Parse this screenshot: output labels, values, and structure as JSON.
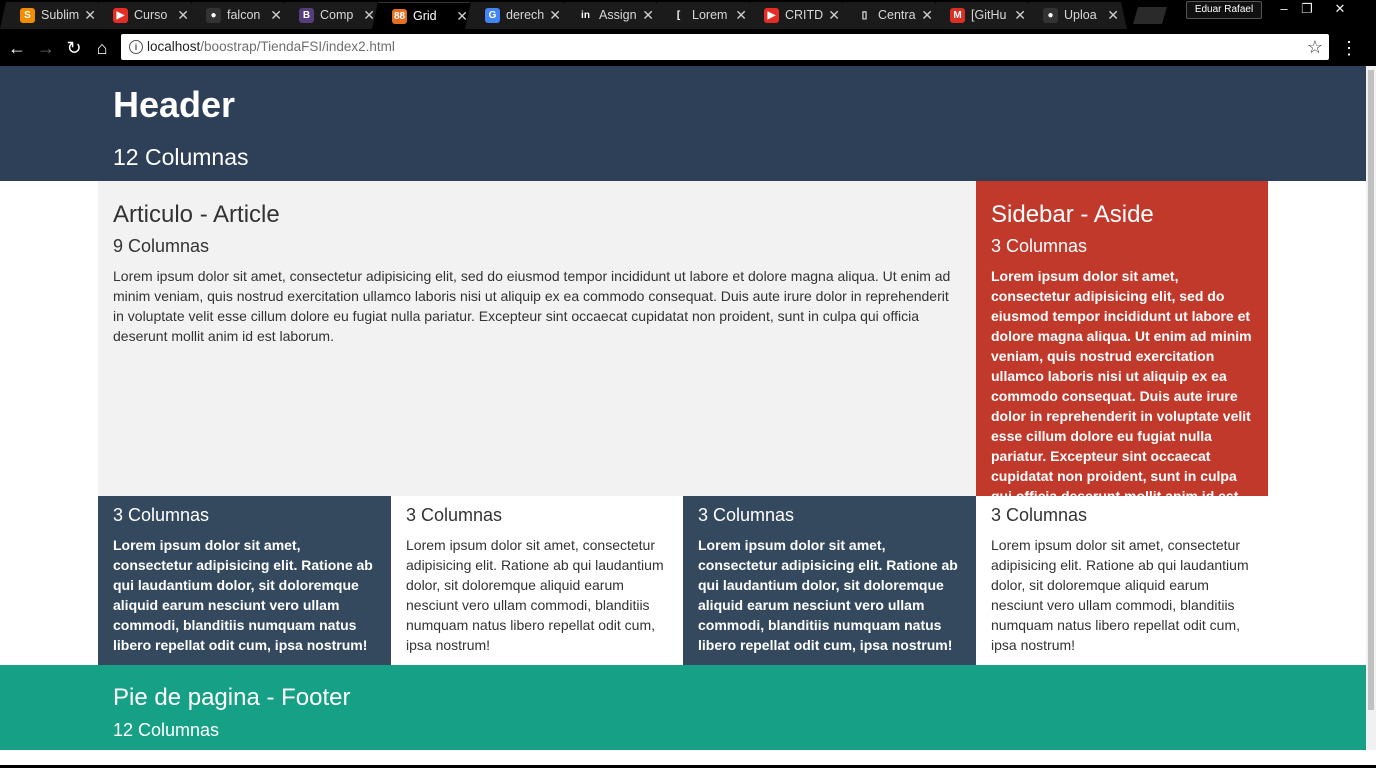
{
  "browser": {
    "tabs": [
      {
        "title": "Sublim",
        "fav": "S",
        "color": "#f28c00"
      },
      {
        "title": "Curso",
        "fav": "▶",
        "color": "#e52d27"
      },
      {
        "title": "falcon",
        "fav": "●",
        "color": "#333333"
      },
      {
        "title": "Comp",
        "fav": "B",
        "color": "#563d7c"
      },
      {
        "title": "Grid",
        "fav": "88",
        "color": "#e76f24",
        "active": true
      },
      {
        "title": "derech",
        "fav": "G",
        "color": "#4285f4"
      },
      {
        "title": "Assign",
        "fav": "in",
        "color": "#1b1b1b"
      },
      {
        "title": "Lorem",
        "fav": "[",
        "color": "#1b1b1b"
      },
      {
        "title": "CRITD",
        "fav": "▶",
        "color": "#e52d27"
      },
      {
        "title": "Centra",
        "fav": "▯",
        "color": "#1b1b1b"
      },
      {
        "title": "[GitHu",
        "fav": "M",
        "color": "#d93025"
      },
      {
        "title": "Uploa",
        "fav": "●",
        "color": "#333333"
      }
    ],
    "profile": "Eduar Rafael",
    "url_host": "localhost",
    "url_path": "/boostrap/TiendaFSI/index2.html"
  },
  "header": {
    "title": "Header",
    "subtitle": "12 Columnas"
  },
  "article": {
    "title": "Articulo - Article",
    "subtitle": "9 Columnas",
    "text": "Lorem ipsum dolor sit amet, consectetur adipisicing elit, sed do eiusmod tempor incididunt ut labore et dolore magna aliqua. Ut enim ad minim veniam, quis nostrud exercitation ullamco laboris nisi ut aliquip ex ea commodo consequat. Duis aute irure dolor in reprehenderit in voluptate velit esse cillum dolore eu fugiat nulla pariatur. Excepteur sint occaecat cupidatat non proident, sunt in culpa qui officia deserunt mollit anim id est laborum."
  },
  "aside": {
    "title": "Sidebar - Aside",
    "subtitle": "3 Columnas",
    "text": "Lorem ipsum dolor sit amet, consectetur adipisicing elit, sed do eiusmod tempor incididunt ut labore et dolore magna aliqua. Ut enim ad minim veniam, quis nostrud exercitation ullamco laboris nisi ut aliquip ex ea commodo consequat. Duis aute irure dolor in reprehenderit in voluptate velit esse cillum dolore eu fugiat nulla pariatur. Excepteur sint occaecat cupidatat non proident, sunt in culpa qui officia deserunt mollit anim id est laborum."
  },
  "columns": [
    {
      "title": "3 Columnas",
      "text": "Lorem ipsum dolor sit amet, consectetur adipisicing elit. Ratione ab qui laudantium dolor, sit doloremque aliquid earum nesciunt vero ullam commodi, blanditiis numquam natus libero repellat odit cum, ipsa nostrum!"
    },
    {
      "title": "3 Columnas",
      "text": "Lorem ipsum dolor sit amet, consectetur adipisicing elit. Ratione ab qui laudantium dolor, sit doloremque aliquid earum nesciunt vero ullam commodi, blanditiis numquam natus libero repellat odit cum, ipsa nostrum!"
    },
    {
      "title": "3 Columnas",
      "text": "Lorem ipsum dolor sit amet, consectetur adipisicing elit. Ratione ab qui laudantium dolor, sit doloremque aliquid earum nesciunt vero ullam commodi, blanditiis numquam natus libero repellat odit cum, ipsa nostrum!"
    },
    {
      "title": "3 Columnas",
      "text": "Lorem ipsum dolor sit amet, consectetur adipisicing elit. Ratione ab qui laudantium dolor, sit doloremque aliquid earum nesciunt vero ullam commodi, blanditiis numquam natus libero repellat odit cum, ipsa nostrum!"
    }
  ],
  "footer": {
    "title": "Pie de pagina - Footer",
    "subtitle": "12 Columnas"
  },
  "colors": {
    "header": "#2e4057",
    "article": "#f2f2f2",
    "aside": "#c0392b",
    "dark_col": "#34495e",
    "footer": "#16a085"
  }
}
